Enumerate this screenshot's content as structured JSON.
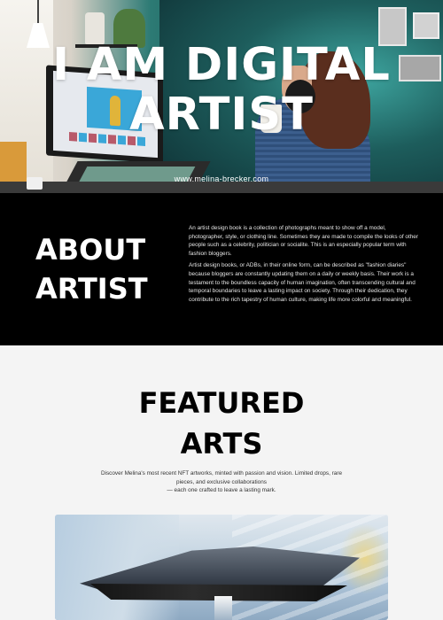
{
  "hero": {
    "title": "I AM DIGITAL ARTIST",
    "url": "www.melina-brecker.com"
  },
  "about": {
    "title": "ABOUT ARTIST",
    "paragraph_1": "An artist design book is a collection of photographs meant to show off a model, photographer, style, or clothing line. Sometimes they are made to compile the looks of other people such as a celebrity, politician or socialite. This is an especially popular term with fashion bloggers.",
    "paragraph_2": "Artist design books, or ADBs, in their online form, can be described as \"fashion diaries\" because bloggers are constantly updating them on a daily or weekly basis. Their work is a testament to the boundless capacity of human imagination, often transcending cultural and temporal boundaries to leave a lasting impact on society. Through their dedication, they contribute to the rich tapestry of human culture, making life more colorful and meaningful."
  },
  "featured": {
    "title": "FEATURED ARTS",
    "description_line_1": "Discover Melina's most recent NFT artworks, minted with passion and vision. Limited drops, rare pieces, and exclusive collaborations",
    "description_line_2": "— each one crafted to leave a lasting mark."
  },
  "colors": {
    "about_background": "#000000",
    "page_background": "#f4f4f4",
    "heading_text_dark": "#000000",
    "heading_text_light": "#ffffff"
  },
  "icons": {
    "artwork": "spaceship-artwork-image",
    "hero_photo": "artist-at-desk-photo"
  }
}
